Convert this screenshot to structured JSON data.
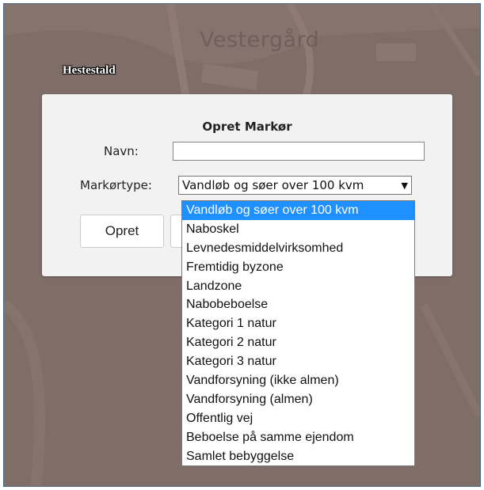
{
  "map": {
    "place_name": "Vestergård",
    "marker_label": "Hestestald"
  },
  "dialog": {
    "title": "Opret Markør",
    "name_label": "Navn:",
    "name_value": "",
    "type_label": "Markørtype:",
    "type_selected": "Vandløb og søer over 100 kvm",
    "create_button": "Opret",
    "cancel_button": ""
  },
  "dropdown": {
    "options": [
      "Vandløb og søer over 100 kvm",
      "Naboskel",
      "Levnedesmiddelvirksomhed",
      "Fremtidig byzone",
      "Landzone",
      "Nabobeboelse",
      "Kategori 1 natur",
      "Kategori 2 natur",
      "Kategori 3 natur",
      "Vandforsyning (ikke almen)",
      "Vandforsyning (almen)",
      "Offentlig vej",
      "Beboelse på samme ejendom",
      "Samlet bebyggelse"
    ]
  },
  "colors": {
    "selected_option": "#1e90ff",
    "dialog_bg": "#f2f2f2",
    "map_overlay": "#7d6b66"
  }
}
